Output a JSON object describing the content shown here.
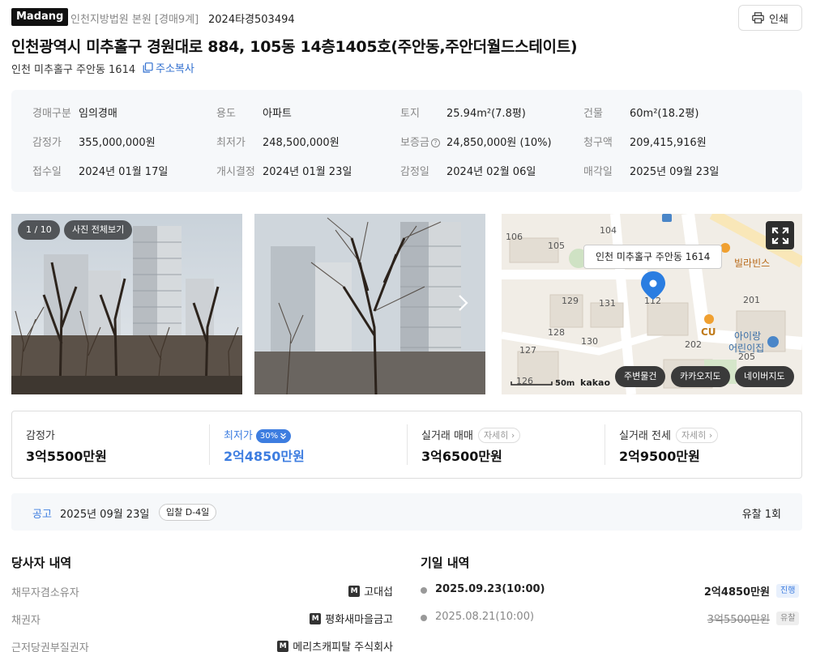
{
  "header": {
    "brand": "Madang",
    "court": "인천지방법원 본원 [경매9계]",
    "case_no": "2024타경503494",
    "print_label": "인쇄"
  },
  "property": {
    "title": "인천광역시 미추홀구 경원대로 884, 105동 14층1405호(주안동,주안더월드스테이트)",
    "short_address": "인천 미추홀구 주안동 1614",
    "copy_address_label": "주소복사"
  },
  "info": {
    "auction_type_label": "경매구분",
    "auction_type": "임의경매",
    "usage_label": "용도",
    "usage": "아파트",
    "land_label": "토지",
    "land": "25.94m²(7.8평)",
    "building_label": "건물",
    "building": "60m²(18.2평)",
    "appraisal_label": "감정가",
    "appraisal": "355,000,000원",
    "min_price_label": "최저가",
    "min_price": "248,500,000원",
    "deposit_label": "보증금",
    "deposit": "24,850,000원 (10%)",
    "claim_label": "청구액",
    "claim": "209,415,916원",
    "received_label": "접수일",
    "received": "2024년 01월 17일",
    "commence_label": "개시결정",
    "commence": "2024년 01월 23일",
    "appraised_label": "감정일",
    "appraised": "2024년 02월 06일",
    "sale_date_label": "매각일",
    "sale_date": "2025년 09월 23일"
  },
  "photos": {
    "counter": "1 / 10",
    "view_all": "사진 전체보기"
  },
  "map": {
    "address_bubble": "인천 미추홀구 주안동 1614",
    "scale_label": "50m",
    "brand": "kakao",
    "buttons": [
      "주변물건",
      "카카오지도",
      "네이버지도"
    ],
    "bldg_labels": [
      "106",
      "105",
      "104",
      "129",
      "131",
      "112",
      "201",
      "128",
      "130",
      "202",
      "127",
      "126",
      "205",
      "CU",
      "아이랑",
      "어린이집",
      "빌라빈스"
    ]
  },
  "prices": {
    "appraisal_label": "감정가",
    "appraisal": "3억5500만원",
    "min_label": "최저가",
    "min_badge": "30%",
    "min": "2억4850만원",
    "trade_label": "실거래 매매",
    "trade_detail": "자세히",
    "trade": "3억6500만원",
    "lease_label": "실거래 전세",
    "lease_detail": "자세히",
    "lease": "2억9500만원"
  },
  "notice": {
    "label": "공고",
    "date": "2025년 09월 23일",
    "dday": "입찰 D-4일",
    "fail_count": "유찰 1회"
  },
  "parties": {
    "title": "당사자 내역",
    "rows": [
      {
        "role": "채무자겸소유자",
        "badge": "M",
        "name": "고대섭"
      },
      {
        "role": "채권자",
        "badge": "M",
        "name": "평화새마을금고"
      },
      {
        "role": "근저당권부질권자",
        "badge": "M",
        "name": "메리츠캐피탈 주식회사"
      }
    ]
  },
  "history": {
    "title": "기일 내역",
    "rows": [
      {
        "date": "2025.09.23(10:00)",
        "amount": "2억4850만원",
        "status": "진행"
      },
      {
        "date": "2025.08.21(10:00)",
        "amount": "3억5500만원",
        "status": "유찰"
      }
    ]
  },
  "colors": {
    "accent": "#3d7de0",
    "bg_panel": "#f6f8fa",
    "map_pin": "#2a7de1"
  }
}
